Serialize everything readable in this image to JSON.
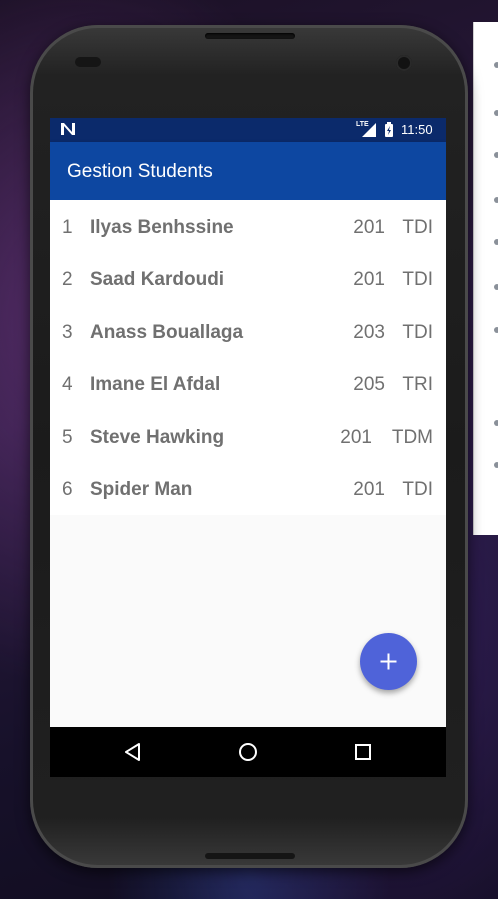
{
  "status_bar": {
    "network_label": "LTE",
    "time": "11:50"
  },
  "app_bar": {
    "title": "Gestion Students"
  },
  "students": [
    {
      "id": "1",
      "name": "Ilyas Benhssine",
      "group": "201",
      "filiere": "TDI"
    },
    {
      "id": "2",
      "name": "Saad Kardoudi",
      "group": "201",
      "filiere": "TDI"
    },
    {
      "id": "3",
      "name": "Anass Bouallaga",
      "group": "203",
      "filiere": "TDI"
    },
    {
      "id": "4",
      "name": "Imane El Afdal",
      "group": "205",
      "filiere": "TRI"
    },
    {
      "id": "5",
      "name": "Steve Hawking",
      "group": "201",
      "filiere": "TDM"
    },
    {
      "id": "6",
      "name": "Spider Man",
      "group": "201",
      "filiere": "TDI"
    }
  ],
  "fab": {
    "icon": "plus-icon",
    "color": "#4f63d9"
  },
  "nav": {
    "icons": [
      "back-icon",
      "home-icon",
      "recents-icon"
    ]
  },
  "colors": {
    "app_bar": "#0d47a1",
    "status_bar": "#0b2a6b",
    "row_text": "#707070"
  }
}
